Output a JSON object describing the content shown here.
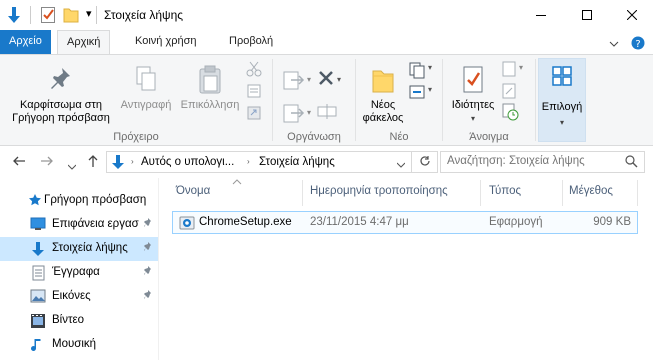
{
  "window": {
    "title": "Στοιχεία λήψης",
    "qat_dropdown": "▾"
  },
  "tabs": [
    {
      "label": "Αρχείο"
    },
    {
      "label": "Αρχική"
    },
    {
      "label": "Κοινή χρήση"
    },
    {
      "label": "Προβολή"
    }
  ],
  "ribbon": {
    "pin_label_1": "Καρφίτσωμα στη",
    "pin_label_2": "Γρήγορη πρόσβαση",
    "copy_label": "Αντιγραφή",
    "paste_label": "Επικόλληση",
    "group_clipboard": "Πρόχειρο",
    "group_organize": "Οργάνωση",
    "new_folder_1": "Νέος",
    "new_folder_2": "φάκελος",
    "group_new": "Νέο",
    "properties_label": "Ιδιότητες",
    "group_open": "Άνοιγμα",
    "select_label": "Επιλογή"
  },
  "address": {
    "segment_1": "Αυτός ο υπολογι...",
    "segment_2": "Στοιχεία λήψης",
    "search_placeholder": "Αναζήτηση: Στοιχεία λήψης"
  },
  "nav": [
    {
      "label": "Γρήγορη πρόσβαση",
      "icon": "star-icon"
    },
    {
      "label": "Επιφάνεια εργασ",
      "icon": "desktop-icon"
    },
    {
      "label": "Στοιχεία λήψης",
      "icon": "download-icon"
    },
    {
      "label": "Έγγραφα",
      "icon": "documents-icon"
    },
    {
      "label": "Εικόνες",
      "icon": "pictures-icon"
    },
    {
      "label": "Βίντεο",
      "icon": "video-icon"
    },
    {
      "label": "Μουσική",
      "icon": "music-icon"
    }
  ],
  "columns": [
    "Όνομα",
    "Ημερομηνία τροποποίησης",
    "Τύπος",
    "Μέγεθος"
  ],
  "files": [
    {
      "name": "ChromeSetup.exe",
      "modified": "23/11/2015 4:47 μμ",
      "type": "Εφαρμογή",
      "size": "909 KB"
    }
  ],
  "colors": {
    "accent": "#1979ca",
    "selected": "#cce8ff"
  }
}
